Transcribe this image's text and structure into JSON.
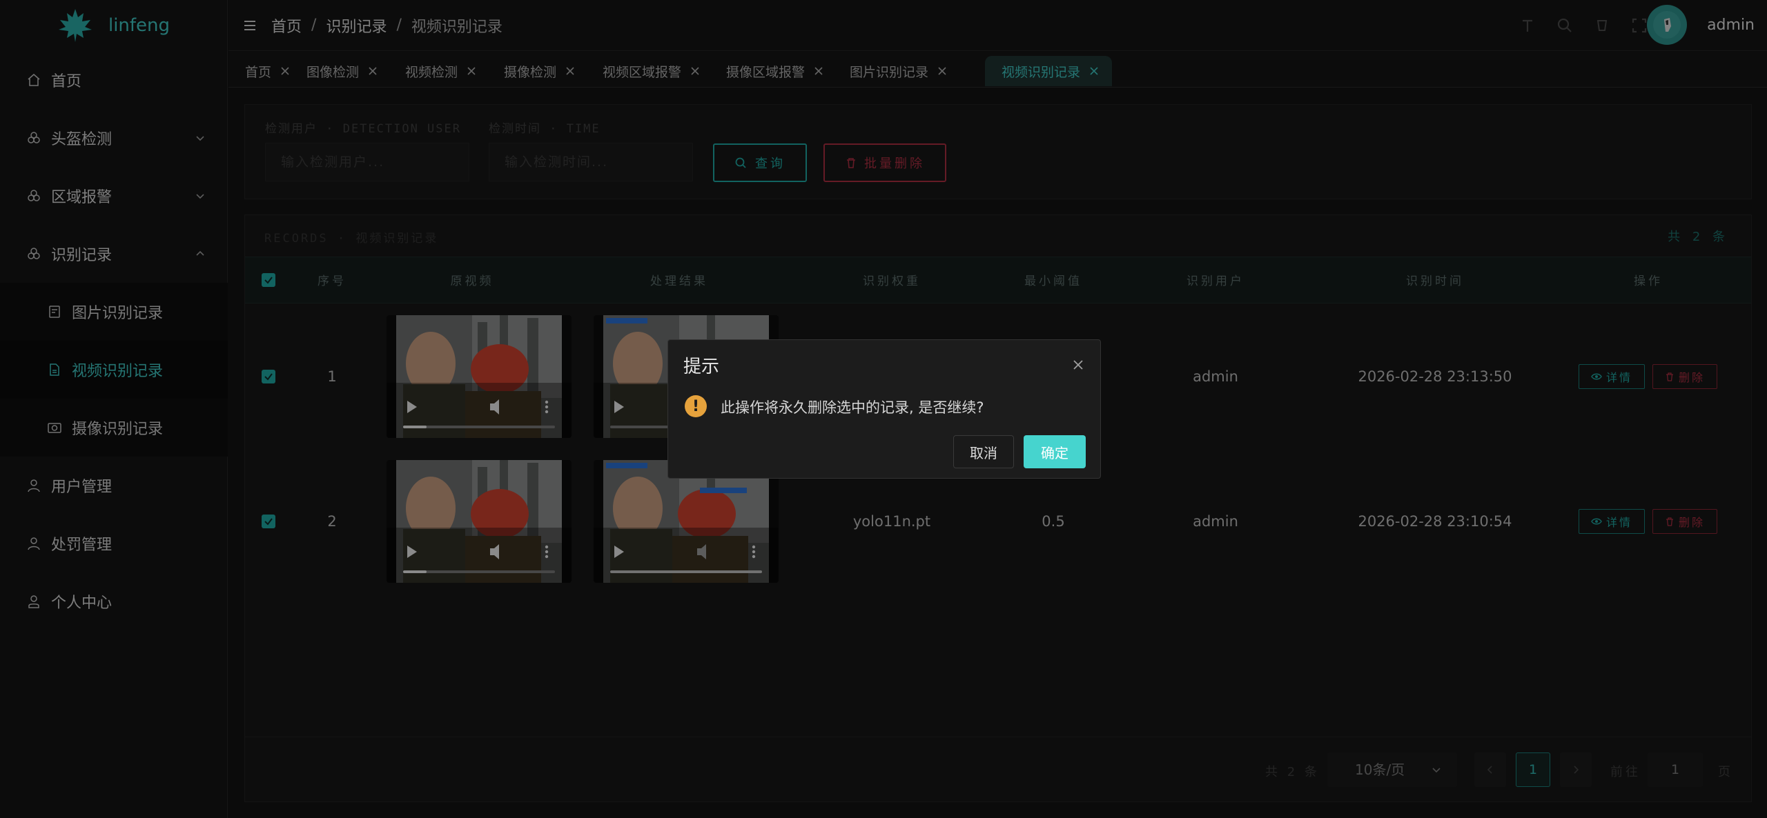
{
  "brand": {
    "name": "linfeng",
    "accent": "#3ec4c0"
  },
  "sidebar": {
    "items": [
      {
        "label": "首页",
        "icon": "home-icon"
      },
      {
        "label": "头盔检测",
        "icon": "helmet-icon",
        "arrow": "chevron-down-icon"
      },
      {
        "label": "区域报警",
        "icon": "alarm-icon",
        "arrow": "chevron-down-icon"
      },
      {
        "label": "识别记录",
        "icon": "record-icon",
        "arrow": "chevron-up-icon",
        "expanded": true
      },
      {
        "label": "图片识别记录",
        "icon": "image-record-icon",
        "sub": true
      },
      {
        "label": "视频识别记录",
        "icon": "video-record-icon",
        "sub": true,
        "active": true
      },
      {
        "label": "摄像识别记录",
        "icon": "camera-record-icon",
        "sub": true
      },
      {
        "label": "用户管理",
        "icon": "user-icon"
      },
      {
        "label": "处罚管理",
        "icon": "punish-icon"
      },
      {
        "label": "个人中心",
        "icon": "profile-icon"
      }
    ]
  },
  "header": {
    "breadcrumb": [
      "首页",
      "识别记录",
      "视频识别记录"
    ],
    "separator": "/",
    "username": "admin"
  },
  "tabs": [
    {
      "label": "首页"
    },
    {
      "label": "图像检测"
    },
    {
      "label": "视频检测"
    },
    {
      "label": "摄像检测"
    },
    {
      "label": "视频区域报警"
    },
    {
      "label": "摄像区域报警"
    },
    {
      "label": "图片识别记录"
    },
    {
      "label": "视频识别记录",
      "active": true
    }
  ],
  "search": {
    "user_label": "检测用户 · DETECTION USER",
    "user_placeholder": "输入检测用户...",
    "time_label": "检测时间 · TIME",
    "time_placeholder": "输入检测时间...",
    "query_label": "查询",
    "batch_delete_label": "批量删除"
  },
  "table": {
    "records_label": "RECORDS · 视频识别记录",
    "total_label": "共 2 条",
    "headers": [
      "序号",
      "原视频",
      "处理结果",
      "识别权重",
      "最小阈值",
      "识别用户",
      "识别时间",
      "操作"
    ],
    "rows": [
      {
        "index": "1",
        "weight": "",
        "threshold": "",
        "user": "admin",
        "time": "2026-02-28 23:13:50",
        "checked": true
      },
      {
        "index": "2",
        "weight": "yolo11n.pt",
        "threshold": "0.5",
        "user": "admin",
        "time": "2026-02-28 23:10:54",
        "checked": true
      }
    ],
    "detail_label": "详情",
    "delete_label": "删除"
  },
  "pagination": {
    "total": "共 2 条",
    "page_size": "10条/页",
    "current_page": "1",
    "goto_label": "前往",
    "goto_value": "1",
    "page_suffix": "页"
  },
  "dialog": {
    "title": "提示",
    "message": "此操作将永久删除选中的记录, 是否继续?",
    "cancel": "取消",
    "confirm": "确定",
    "warn_color": "#e6a23c",
    "confirm_color": "#46d4ce"
  }
}
